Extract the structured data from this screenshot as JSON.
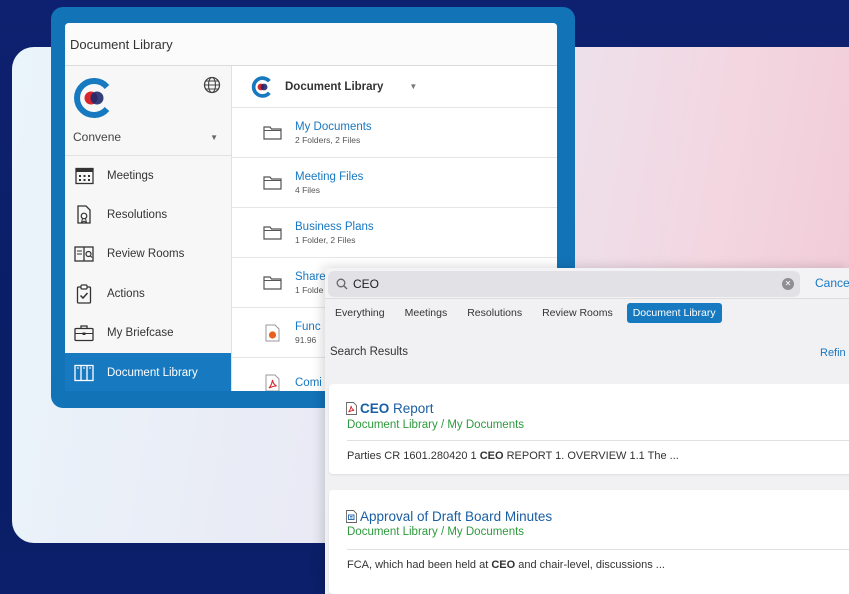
{
  "window": {
    "title": "Document Library"
  },
  "sidebar": {
    "org_name": "Convene",
    "items": [
      {
        "label": "Meetings",
        "icon": "calendar-icon"
      },
      {
        "label": "Resolutions",
        "icon": "resolution-document-icon"
      },
      {
        "label": "Review Rooms",
        "icon": "review-room-icon"
      },
      {
        "label": "Actions",
        "icon": "clipboard-check-icon"
      },
      {
        "label": "My Briefcase",
        "icon": "briefcase-icon"
      },
      {
        "label": "Document Library",
        "icon": "library-icon",
        "active": true
      }
    ]
  },
  "content": {
    "header": "Document Library",
    "rows": [
      {
        "name": "My Documents",
        "meta": "2 Folders, 2 Files",
        "icon": "folder-icon"
      },
      {
        "name": "Meeting Files",
        "meta": "4 Files",
        "icon": "folder-icon"
      },
      {
        "name": "Business Plans",
        "meta": "1 Folder, 2 Files",
        "icon": "folder-icon"
      },
      {
        "name": "Share",
        "meta": "1 Folde",
        "icon": "folder-icon"
      },
      {
        "name": "Func",
        "meta": "91.96 ",
        "icon": "powerpoint-file-icon"
      },
      {
        "name": "Comi",
        "meta": "",
        "icon": "pdf-file-icon"
      }
    ]
  },
  "search": {
    "query": "CEO",
    "cancel_label": "Cance",
    "tabs": [
      "Everything",
      "Meetings",
      "Resolutions",
      "Review Rooms",
      "Document Library"
    ],
    "active_tab": "Document Library",
    "results_label": "Search Results",
    "refine_label": "Refin",
    "results": [
      {
        "icon": "pdf-file-icon",
        "title_highlight": "CEO",
        "title_rest": " Report",
        "path": "Document Library / My Documents",
        "snippet_before": "Parties CR 1601.280420 1 ",
        "snippet_highlight": "CEO",
        "snippet_after": " REPORT 1. OVERVIEW 1.1 The ..."
      },
      {
        "icon": "word-file-icon",
        "title_highlight": "",
        "title_rest": "Approval of Draft Board Minutes",
        "path": "Document Library / My Documents",
        "snippet_before": "FCA, which had been held at ",
        "snippet_highlight": "CEO",
        "snippet_after": " and chair-level, discussions ..."
      }
    ]
  },
  "colors": {
    "brand_blue": "#1779bf",
    "link_blue": "#1878c2",
    "path_green": "#2d9a3d",
    "logo_red": "#d7262d"
  }
}
